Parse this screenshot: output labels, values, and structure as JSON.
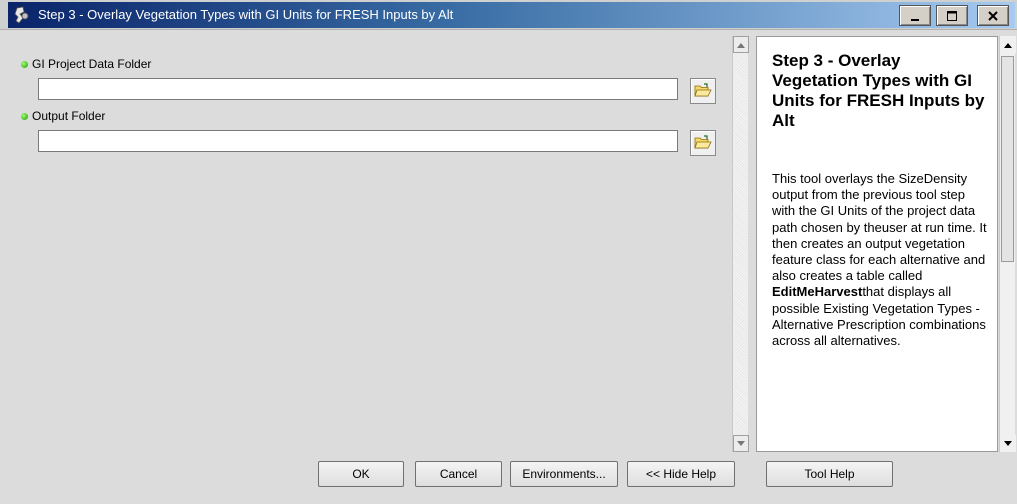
{
  "window": {
    "title": "Step 3 - Overlay Vegetation Types with GI Units for FRESH Inputs by Alt",
    "controls": [
      "minimize-icon",
      "maximize-icon",
      "close-icon"
    ]
  },
  "params": [
    {
      "label": "GI Project Data Folder",
      "value": "",
      "icon": "folder-open-icon"
    },
    {
      "label": "Output Folder",
      "value": "",
      "icon": "folder-open-icon"
    }
  ],
  "help": {
    "title": "Step 3 - Overlay Vegetation Types with GI Units for FRESH Inputs by Alt",
    "text_before": "This tool overlays the SizeDensity output from the previous tool step with the GI Units of the project data path chosen by theuser at run time. It then creates an output vegetation feature class for each alternative and also creates a table called ",
    "text_bold": "EditMeHarvest",
    "text_after": "that displays all possible Existing Vegetation Types - Alternative Prescription combinations across all alternatives."
  },
  "buttons": {
    "ok": "OK",
    "cancel": "Cancel",
    "environments": "Environments...",
    "hide_help": "<< Hide Help",
    "tool_help": "Tool Help"
  },
  "colors": {
    "bullet": "#1c9a00",
    "title_bar": "#0a246a"
  }
}
